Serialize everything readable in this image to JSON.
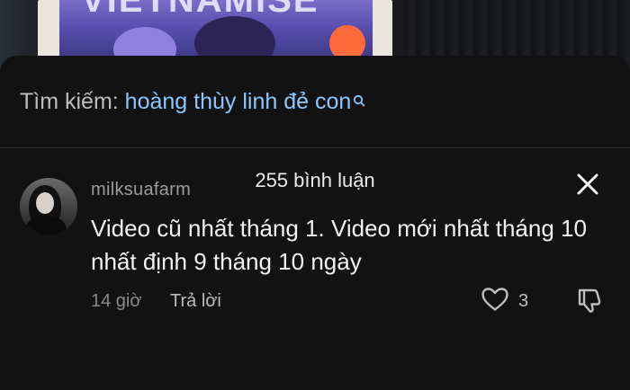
{
  "video": {
    "poster_title": "VIETNAMISE"
  },
  "search": {
    "prefix": "Tìm kiếm:",
    "term": "hoàng thùy linh đẻ con",
    "icon": "search-icon"
  },
  "comments_panel": {
    "count_label": "255 bình luận",
    "close_icon": "close-icon"
  },
  "comment": {
    "username": "milksuafarm",
    "text": "Video cũ nhất tháng 1. Video mới nhất tháng 10 nhất định 9 tháng 10 ngày",
    "time": "14 giờ",
    "reply_label": "Trả lời",
    "like_count": "3",
    "like_icon": "heart-outline-icon",
    "dislike_icon": "dislike-icon"
  },
  "colors": {
    "search_term": "#8cc8ff",
    "sheet_bg": "#121212"
  }
}
